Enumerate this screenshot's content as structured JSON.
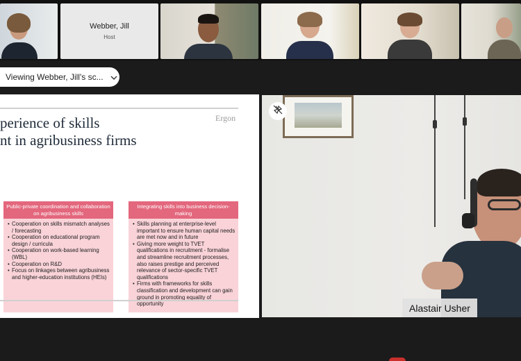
{
  "gallery": {
    "host": {
      "name": "Webber, Jill",
      "role": "Host"
    }
  },
  "share": {
    "viewing_label": "Viewing Webber, Jill's sc...",
    "slide": {
      "brand": "Ergon",
      "title_line1": "perience of skills",
      "title_line2": "nt in agribusiness firms",
      "box1": {
        "heading": "Public-private coordination and collaboration on agribusiness skills",
        "bullets": [
          "Cooperation on skills mismatch analyses / forecasting",
          "Cooperation on educational program design / curricula",
          "Cooperation on work-based learning (WBL)",
          "Cooperation on R&D",
          "Focus on linkages between agribusiness and higher-education institutions (HEIs)"
        ]
      },
      "box2": {
        "heading": "Integrating skills into business decision-making",
        "bullets": [
          "Skills planning at enterprise-level important to ensure human capital needs are met now and in future",
          "Giving more weight to TVET qualifications in recruitment - formalise and streamline recruitment processes, also raises prestige and perceived relevance of sector-specific TVET qualifications",
          "Firms with frameworks for skills classification and development can gain ground in promoting equality of opportunity"
        ]
      }
    }
  },
  "speaker": {
    "name": "Alastair Usher"
  },
  "colors": {
    "box_header": "#e3677d",
    "box_body": "#f9d3d8",
    "end_button": "#c9302c"
  },
  "icons": [
    "chevron-down-icon",
    "unpin-icon"
  ]
}
